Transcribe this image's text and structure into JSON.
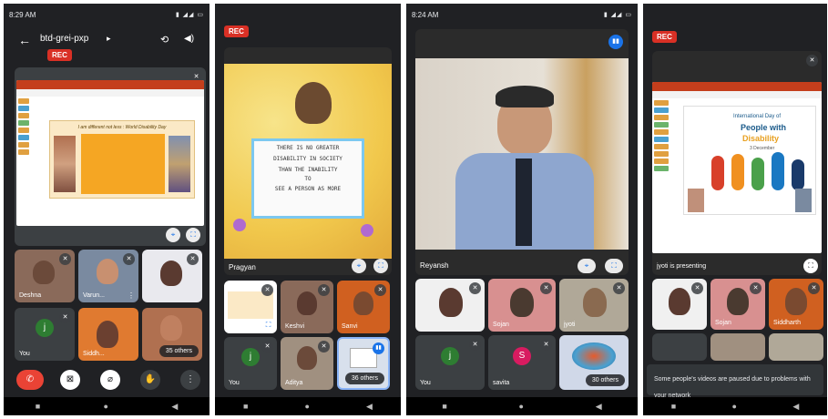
{
  "screen1": {
    "status_time": "8:29 AM",
    "meeting_title": "btd-grei-pxp",
    "rec_label": "REC",
    "slide_heading": "I am different not less : World Disability Day",
    "participants": [
      {
        "name": "Deshna"
      },
      {
        "name": "Varun..."
      },
      {
        "name": ""
      },
      {
        "name": "You",
        "initial": "j"
      },
      {
        "name": "Siddh..."
      },
      {
        "name": ""
      }
    ],
    "others_label": "35 others"
  },
  "screen2": {
    "rec_label": "REC",
    "speaker_name": "Pragyan",
    "poster_lines": [
      "THERE IS NO GREATER",
      "DISABILITY IN SOCIETY",
      "THAN THE INABILITY",
      "TO",
      "SEE A PERSON AS MORE"
    ],
    "participants": [
      {
        "name": ""
      },
      {
        "name": "Keshvi"
      },
      {
        "name": "Sanvi"
      },
      {
        "name": "You",
        "initial": "j"
      },
      {
        "name": "Aditya"
      },
      {
        "name": ""
      }
    ],
    "others_label": "36 others"
  },
  "screen3": {
    "status_time": "8:24 AM",
    "speaker_name": "Reyansh",
    "participants": [
      {
        "name": ""
      },
      {
        "name": "Sojan"
      },
      {
        "name": "jyoti"
      },
      {
        "name": "You",
        "initial": "j"
      },
      {
        "name": "savita",
        "initial": "S"
      },
      {
        "name": ""
      }
    ],
    "others_label": "30 others"
  },
  "screen4": {
    "rec_label": "REC",
    "slide_line1": "International Day of",
    "slide_line2": "People with",
    "slide_line3": "Disability",
    "slide_date": "3 December",
    "presenting_label": "jyoti is presenting",
    "participants": [
      {
        "name": ""
      },
      {
        "name": "Sojan"
      },
      {
        "name": "Siddharth"
      }
    ],
    "network_notice": "Some people's videos are paused due to problems with your network"
  },
  "colors": {
    "bg": "#202124",
    "tile": "#3c4043",
    "rec": "#d93025",
    "hangup": "#ea4335",
    "avatar_green": "#2e7d32",
    "avatar_pink": "#d81b60"
  }
}
